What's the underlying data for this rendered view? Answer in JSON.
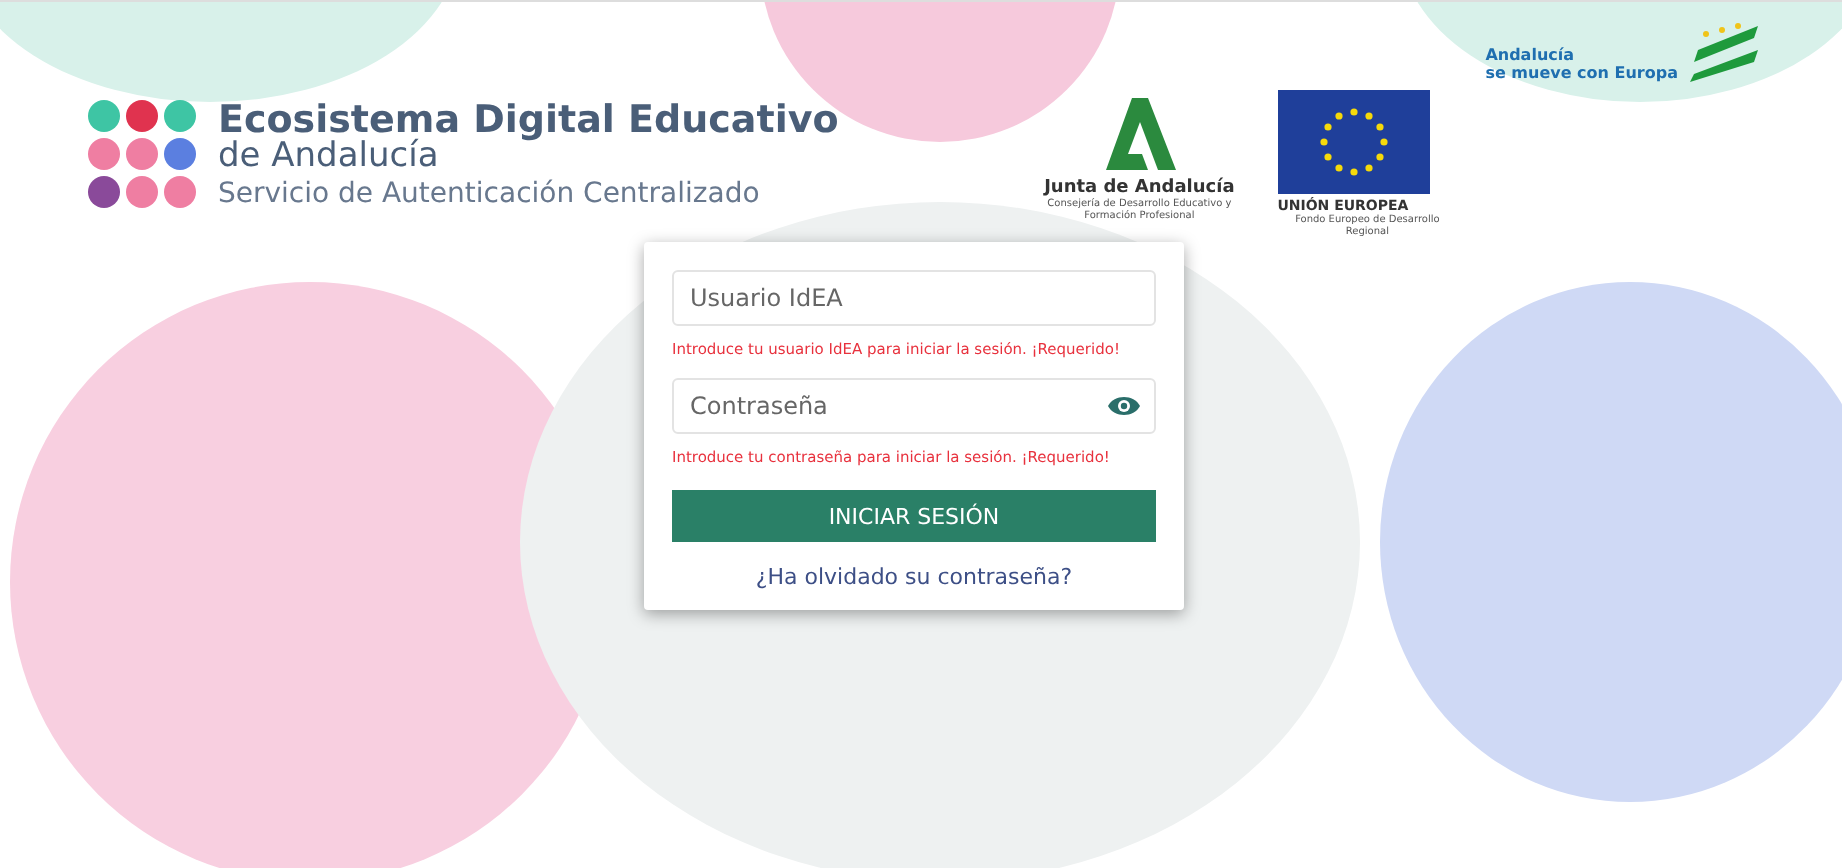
{
  "header": {
    "logo": {
      "title": "Ecosistema Digital Educativo",
      "subtitle": "de Andalucía",
      "tagline": "Servicio de Autenticación Centralizado"
    },
    "partners": [
      {
        "kind": "junta",
        "name": "Junta de Andalucía",
        "detail": "Consejería de Desarrollo Educativo y Formación Profesional"
      },
      {
        "kind": "eu",
        "name": "UNIÓN EUROPEA",
        "detail": "Fondo Europeo de Desarrollo Regional"
      },
      {
        "kind": "andalucia",
        "name": "Andalucía",
        "detail": "se mueve con Europa"
      }
    ]
  },
  "login": {
    "fields": [
      {
        "kind": "text",
        "placeholder": "Usuario IdEA",
        "error": "Introduce tu usuario IdEA para iniciar la sesión. ¡Requerido!"
      },
      {
        "kind": "password",
        "placeholder": "Contraseña",
        "error": "Introduce tu contraseña para iniciar la sesión. ¡Requerido!"
      }
    ],
    "submit": "INICIAR SESIÓN",
    "forgot": "¿Ha olvidado su contraseña?"
  }
}
